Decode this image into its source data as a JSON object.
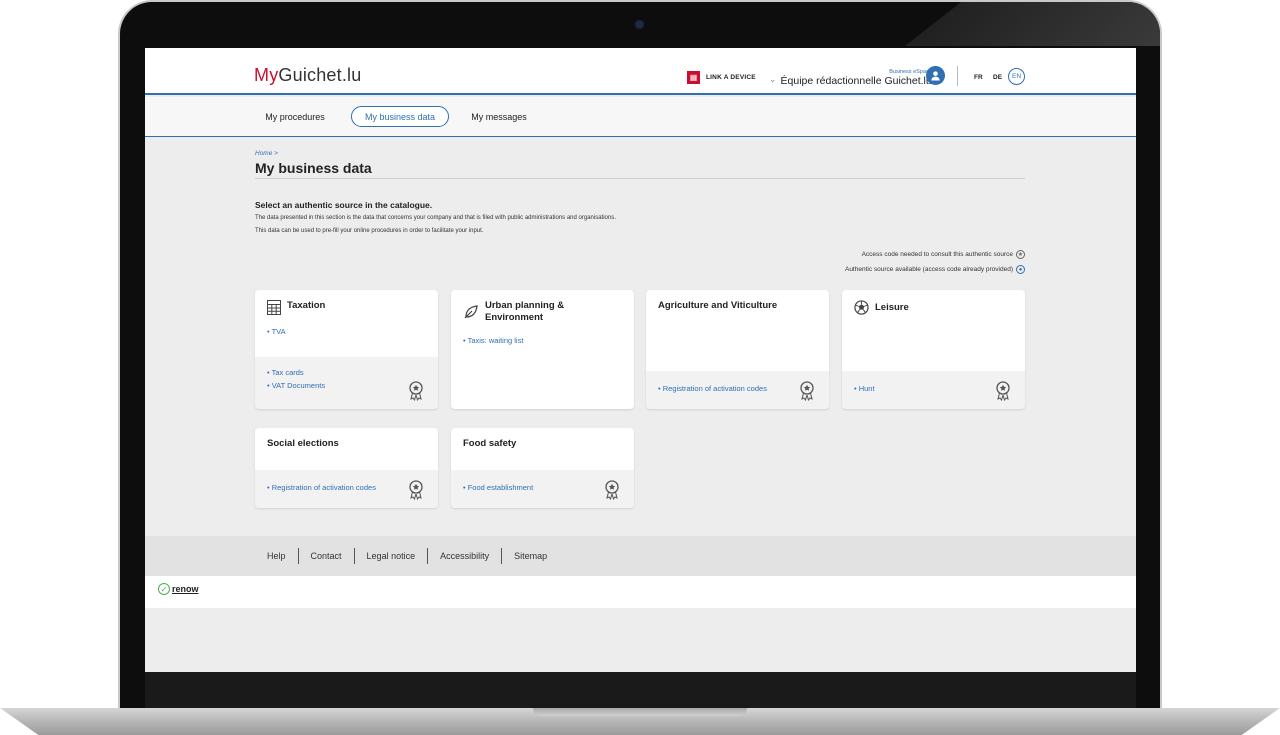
{
  "header": {
    "logo_my": "My",
    "logo_rest": "Guichet.lu",
    "link_device": "LINK A DEVICE",
    "space_label": "Business eSpace",
    "account_name": "Équipe rédactionnelle Guichet.lu",
    "languages": {
      "fr": "FR",
      "de": "DE",
      "en": "EN"
    }
  },
  "nav": {
    "procedures": "My procedures",
    "business_data": "My business data",
    "messages": "My messages"
  },
  "breadcrumb": "Home  >",
  "page_title": "My business data",
  "intro": {
    "heading": "Select an authentic source in the catalogue.",
    "line1": "The data presented in this section is the data that concerns your company and that is filed with public administrations and organisations.",
    "line2": "This data can be used to pre-fill your online procedures in order to facilitate your input."
  },
  "legend": {
    "access_needed": "Access code needed to consult this authentic source",
    "available": "Authentic source available (access code already provided)"
  },
  "cards": {
    "taxation": {
      "title": "Taxation",
      "top_items": [
        "TVA"
      ],
      "bottom_items": [
        "Tax cards",
        "VAT Documents"
      ]
    },
    "urban": {
      "title_line1": "Urban planning &",
      "title_line2": "Environment",
      "top_items": [
        "Taxis: waiting list"
      ]
    },
    "agri": {
      "title": "Agriculture and Viticulture",
      "bottom_items": [
        "Registration of activation codes"
      ]
    },
    "leisure": {
      "title": "Leisure",
      "bottom_items": [
        "Hunt"
      ]
    },
    "social": {
      "title": "Social elections",
      "bottom_items": [
        "Registration of activation codes"
      ]
    },
    "food": {
      "title": "Food safety",
      "bottom_items": [
        "Food establishment"
      ]
    }
  },
  "footer": {
    "links": [
      "Help",
      "Contact",
      "Legal notice",
      "Accessibility",
      "Sitemap"
    ],
    "renow": "renow"
  },
  "colors": {
    "brand_red": "#c8102e",
    "accent_blue": "#2f6fb3"
  }
}
